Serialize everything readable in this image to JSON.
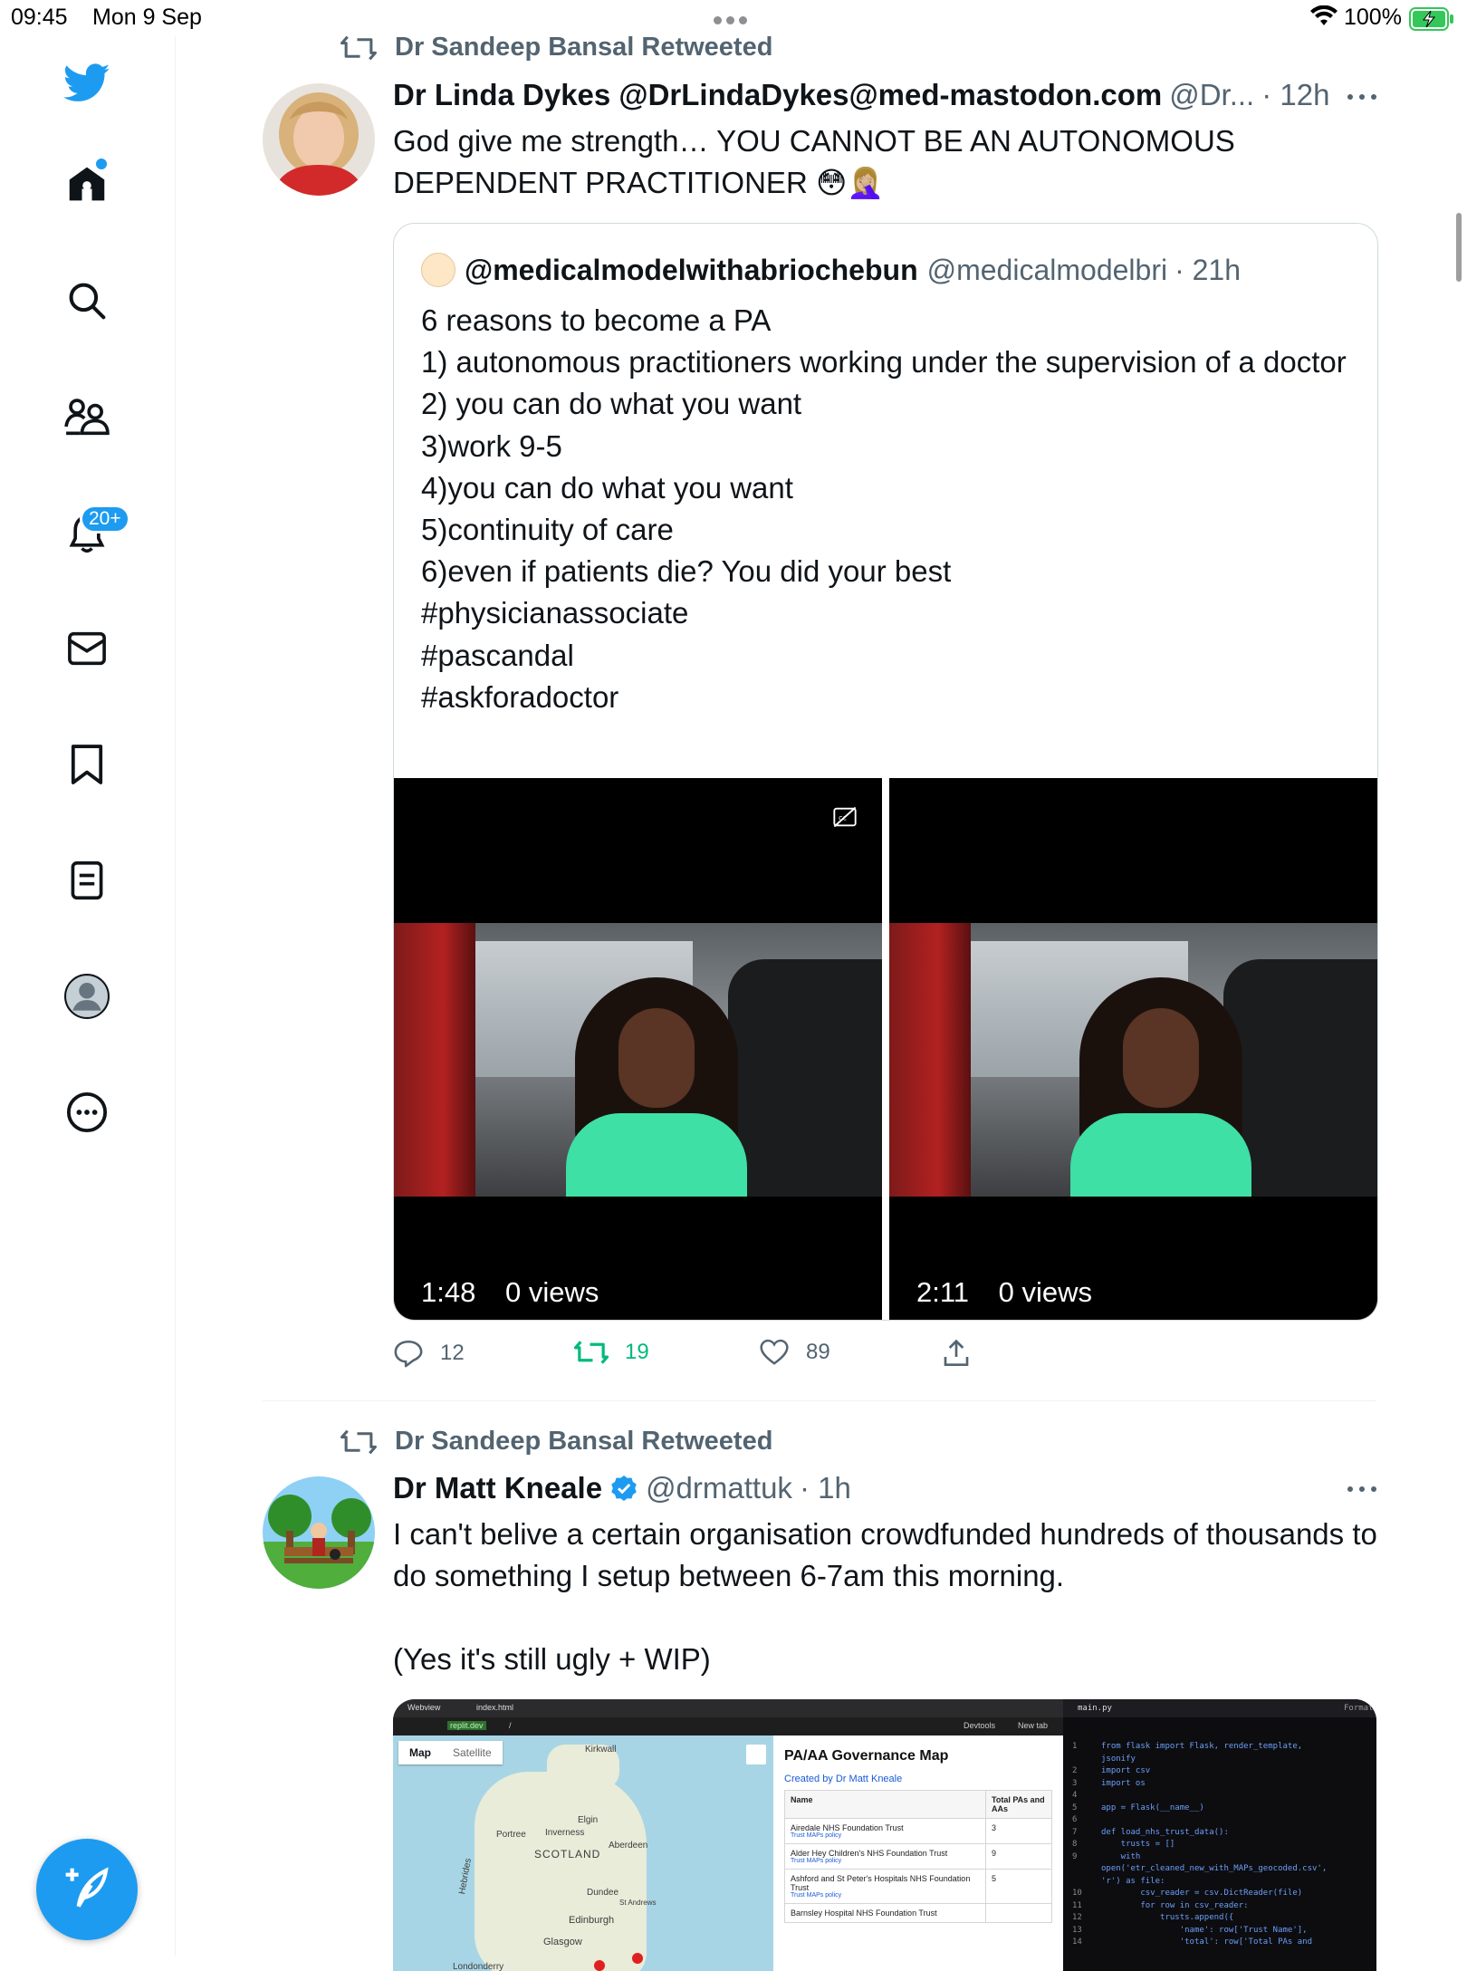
{
  "status_bar": {
    "time": "09:45",
    "date": "Mon 9 Sep",
    "battery_percent": "100%"
  },
  "sidebar": {
    "items": [
      {
        "name": "twitter-logo",
        "icon": "bird-icon"
      },
      {
        "name": "home",
        "icon": "home-icon",
        "has_dot": true
      },
      {
        "name": "search",
        "icon": "search-icon"
      },
      {
        "name": "communities",
        "icon": "communities-icon"
      },
      {
        "name": "notifications",
        "icon": "bell-icon",
        "badge": "20+"
      },
      {
        "name": "messages",
        "icon": "envelope-icon"
      },
      {
        "name": "bookmarks",
        "icon": "bookmark-icon"
      },
      {
        "name": "lists",
        "icon": "list-icon"
      },
      {
        "name": "profile",
        "icon": "avatar-icon"
      },
      {
        "name": "more",
        "icon": "more-circle-icon"
      }
    ],
    "compose_icon": "compose-feather-icon"
  },
  "colors": {
    "accent": "#1d9bf0",
    "text_primary": "#0f1419",
    "text_secondary": "#536471",
    "retweet_active": "#00ba7c",
    "border": "#cfd9de"
  },
  "tweets": [
    {
      "retweeted_by": "Dr Sandeep Bansal Retweeted",
      "author_name": "Dr Linda Dykes @DrLindaDykes@med-mastodon.com",
      "author_handle": "@Dr...",
      "time": "· 12h",
      "text": "God give me strength… YOU CANNOT BE AN AUTONOMOUS DEPENDENT PRACTITIONER 😳🤦🏼‍♀️",
      "quote": {
        "author_name": "@medicalmodelwithabriochebun",
        "author_handle": "@medicalmodelbri",
        "time": "· 21h",
        "text": "6 reasons to become a PA\n1) autonomous practitioners working under the supervision of a doctor\n2) you can do what you want\n3)work 9-5\n4)you can do what you want\n5)continuity of care\n6)even if patients die? You did your best\n#physicianassociate\n#pascandal\n#askforadoctor",
        "videos": [
          {
            "duration": "1:48",
            "views": "0 views"
          },
          {
            "duration": "2:11",
            "views": "0 views"
          }
        ]
      },
      "actions": {
        "replies": "12",
        "retweets": "19",
        "likes": "89"
      }
    },
    {
      "retweeted_by": "Dr Sandeep Bansal Retweeted",
      "author_name": "Dr Matt Kneale",
      "author_handle": "@drmattuk",
      "time": "· 1h",
      "text": "I can't belive a certain organisation crowdfunded hundreds of thousands to do something I setup between 6-7am this morning.\n\n(Yes it's still ugly + WIP)",
      "image": {
        "tab_webview": "Webview",
        "tab_index": "index.html",
        "url": "replit.dev",
        "url_path": "/",
        "devtools": "Devtools",
        "new_tab": "New tab",
        "map_toggle": [
          "Map",
          "Satellite"
        ],
        "map_labels": [
          "Kirkwall",
          "Inverness",
          "SCOTLAND",
          "Aberdeen",
          "Dundee",
          "Edinburgh",
          "Glasgow",
          "Hebrides",
          "Portree",
          "Elgin",
          "St Andrews",
          "Londonderry"
        ],
        "panel_title": "PA/AA Governance Map",
        "panel_subtitle": "Created by Dr Matt Kneale",
        "table_headers": [
          "Name",
          "Total PAs and AAs"
        ],
        "table_rows": [
          {
            "name": "Airedale NHS Foundation Trust",
            "link": "Trust MAPs policy",
            "total": "3"
          },
          {
            "name": "Alder Hey Children's NHS Foundation Trust",
            "link": "Trust MAPs policy",
            "total": "9"
          },
          {
            "name": "Ashford and St Peter's Hospitals NHS Foundation Trust",
            "link": "Trust MAPs policy",
            "total": "5"
          },
          {
            "name": "Barnsley Hospital NHS Foundation Trust",
            "link": "",
            "total": ""
          }
        ],
        "code_tab": "main.py",
        "code_format": "Format",
        "code_line_numbers": "1\n\n2\n3\n4\n5\n6\n7\n8\n9\n\n\n10\n11\n12\n13\n14",
        "code_text": "from flask import Flask, render_template,\njsonify\nimport csv\nimport os\n\napp = Flask(__name__)\n\ndef load_nhs_trust_data():\n    trusts = []\n    with\nopen('etr_cleaned_new_with_MAPs_geocoded.csv',\n'r') as file:\n        csv_reader = csv.DictReader(file)\n        for row in csv_reader:\n            trusts.append({\n                'name': row['Trust Name'],\n                'total': row['Total PAs and"
      }
    }
  ]
}
